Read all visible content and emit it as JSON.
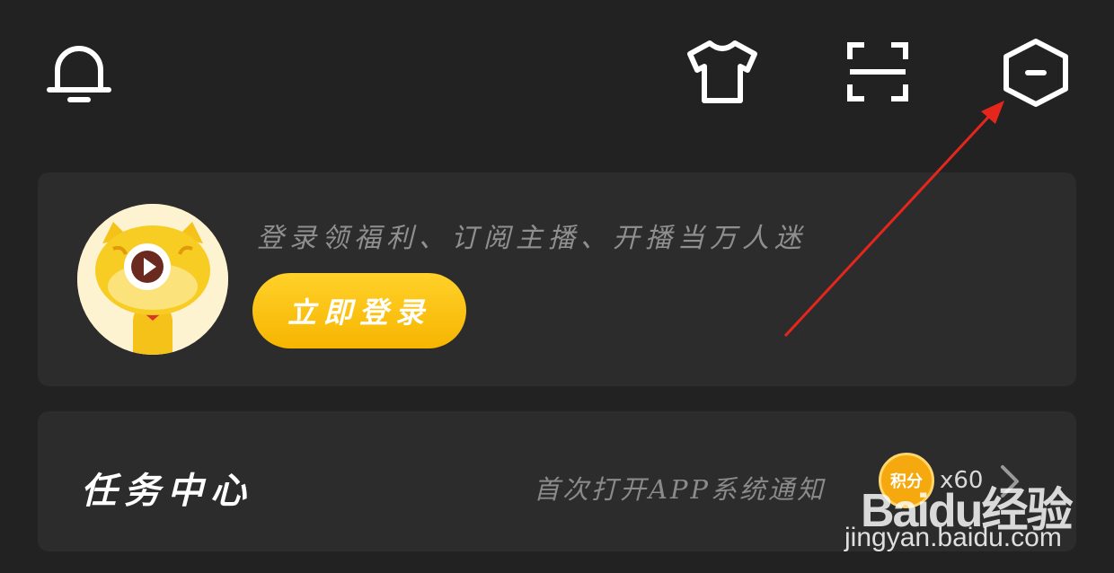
{
  "top_bar": {
    "icons": [
      "bell-icon",
      "tshirt-icon",
      "scan-icon",
      "settings-hexagon-icon"
    ]
  },
  "login_card": {
    "tagline": "登录领福利、订阅主播、开播当万人迷",
    "login_button_label": "立即登录"
  },
  "task_card": {
    "title": "任务中心",
    "description": "首次打开APP系统通知",
    "points_badge": "积分",
    "points_value": "x60"
  },
  "watermark": {
    "logo_text": "Baidu经验",
    "url_text": "jingyan.baidu.com"
  },
  "colors": {
    "background": "#222223",
    "card": "#2c2c2d",
    "accent_yellow": "#f7b500",
    "annotation_arrow": "#e5261d"
  }
}
